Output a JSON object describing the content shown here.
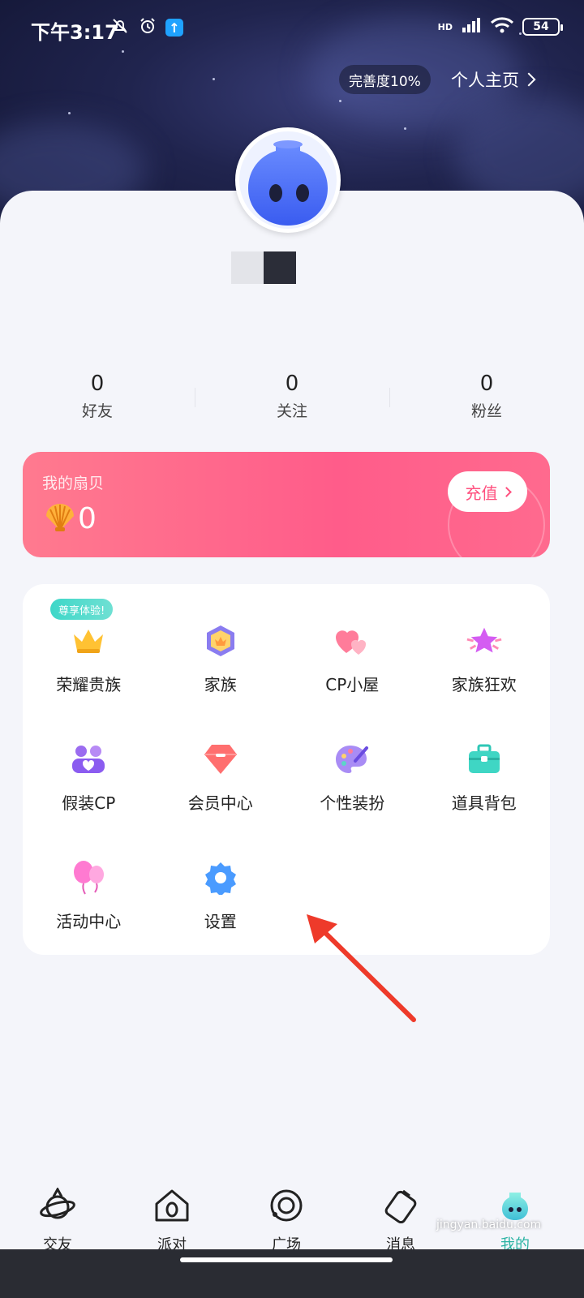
{
  "status_bar": {
    "time": "下午3:17",
    "battery": "54",
    "network": "HD"
  },
  "header": {
    "completeness": "完善度10%",
    "homepage_link": "个人主页"
  },
  "stats": [
    {
      "value": "0",
      "label": "好友"
    },
    {
      "value": "0",
      "label": "关注"
    },
    {
      "value": "0",
      "label": "粉丝"
    }
  ],
  "wallet": {
    "title": "我的扇贝",
    "amount": "0",
    "recharge_label": "充值"
  },
  "services": {
    "promo_tag": "尊享体验!",
    "items": [
      {
        "label": "荣耀贵族",
        "icon": "crown-icon"
      },
      {
        "label": "家族",
        "icon": "family-badge-icon"
      },
      {
        "label": "CP小屋",
        "icon": "hearts-icon"
      },
      {
        "label": "家族狂欢",
        "icon": "star-burst-icon"
      },
      {
        "label": "假装CP",
        "icon": "couple-icon"
      },
      {
        "label": "会员中心",
        "icon": "gem-icon"
      },
      {
        "label": "个性装扮",
        "icon": "palette-icon"
      },
      {
        "label": "道具背包",
        "icon": "toolbox-icon"
      },
      {
        "label": "活动中心",
        "icon": "balloon-icon"
      },
      {
        "label": "设置",
        "icon": "gear-icon"
      }
    ]
  },
  "tab_bar": [
    {
      "label": "交友",
      "icon": "planet-icon"
    },
    {
      "label": "派对",
      "icon": "house-icon"
    },
    {
      "label": "广场",
      "icon": "orbit-icon"
    },
    {
      "label": "消息",
      "icon": "message-icon"
    },
    {
      "label": "我的",
      "icon": "profile-icon"
    }
  ],
  "watermark": "jingyan.baidu.com"
}
